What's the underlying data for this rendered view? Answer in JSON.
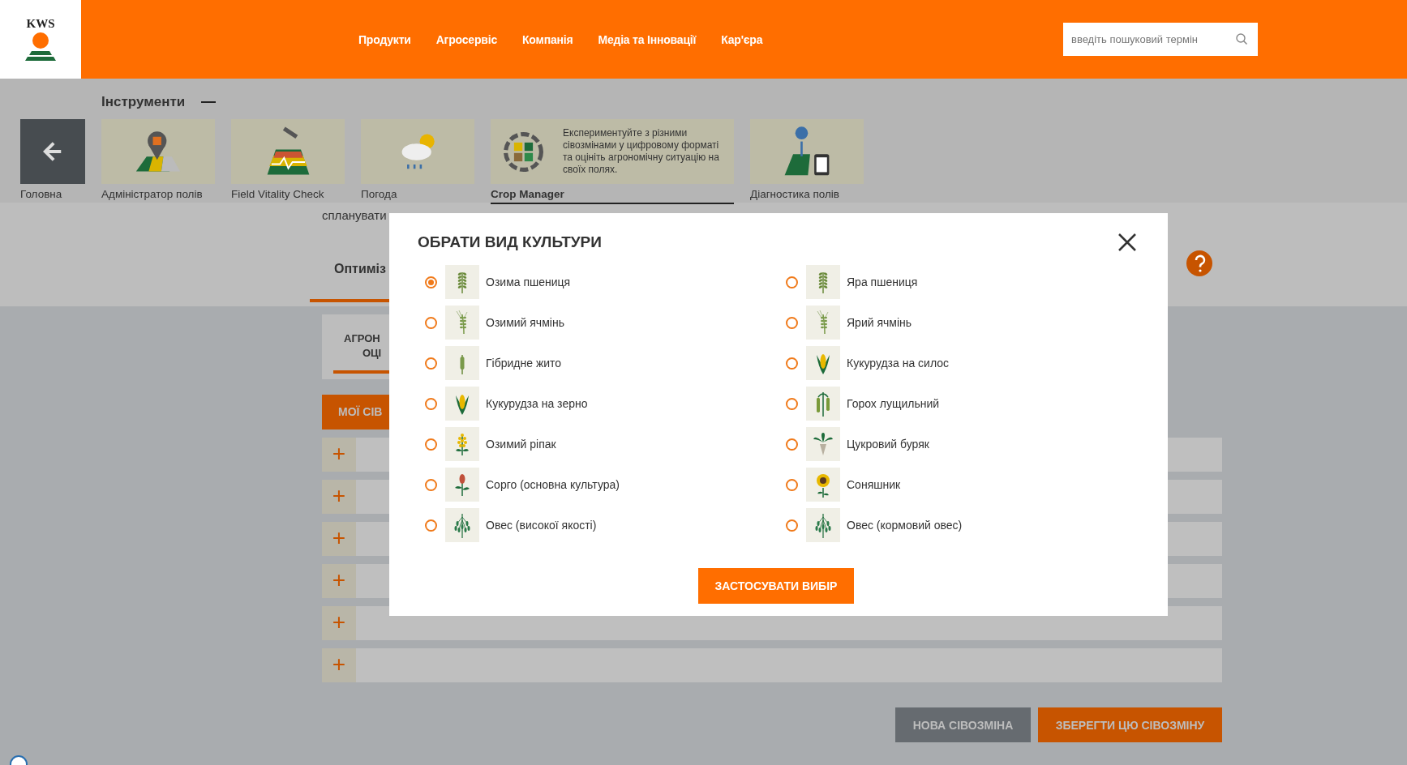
{
  "header": {
    "logo": "KWS",
    "nav": [
      "Продукти",
      "Агросервіс",
      "Компанія",
      "Медіа та Інновації",
      "Кар'єра"
    ],
    "search": {
      "placeholder": "введіть пошуковий термін"
    }
  },
  "tools": {
    "title": "Інструменти",
    "items": [
      {
        "kind": "back",
        "label": "Головна",
        "selected": false
      },
      {
        "kind": "field-admin",
        "label": "Адміністратор полів",
        "selected": false
      },
      {
        "kind": "vitality",
        "label": "Field Vitality Check",
        "selected": false
      },
      {
        "kind": "weather",
        "label": "Погода",
        "selected": false
      },
      {
        "kind": "crop-manager",
        "label": "Crop Manager",
        "description": "Експериментуйте з різними сівозмінами у цифровому форматі та оцініть агрономічну ситуацію на своїх полях.",
        "selected": true
      },
      {
        "kind": "diagnostics",
        "label": "Діагностика полів",
        "selected": false
      }
    ]
  },
  "intro": "спланувати",
  "tab": "Оптиміз",
  "card_lines": [
    "АГРОН",
    "ОЦІ"
  ],
  "my_rotations_button": "МОЇ СІВ",
  "rotation_rows": [
    "+",
    "+",
    "+",
    "+",
    "+",
    "+"
  ],
  "footer_buttons": [
    {
      "kind": "secondary",
      "label": "НОВА СІВОЗМІНА"
    },
    {
      "kind": "primary",
      "label": "ЗБЕРЕГТИ ЦЮ СІВОЗМІНУ"
    }
  ],
  "dialog": {
    "title": "ОБРАТИ ВИД КУЛЬТУРИ",
    "crops": [
      {
        "kind": "wheat",
        "label": "Озима пшениця",
        "selected": true
      },
      {
        "kind": "wheat",
        "label": "Яра пшениця",
        "selected": false
      },
      {
        "kind": "barley",
        "label": "Озимий ячмінь",
        "selected": false
      },
      {
        "kind": "barley",
        "label": "Ярий ячмінь",
        "selected": false
      },
      {
        "kind": "rye",
        "label": "Гібридне жито",
        "selected": false
      },
      {
        "kind": "corn",
        "label": "Кукурудза на силос",
        "selected": false
      },
      {
        "kind": "corn",
        "label": "Кукурудза на зерно",
        "selected": false
      },
      {
        "kind": "pea",
        "label": "Горох лущильний",
        "selected": false
      },
      {
        "kind": "rapeseed",
        "label": "Озимий ріпак",
        "selected": false
      },
      {
        "kind": "beet",
        "label": "Цукровий буряк",
        "selected": false
      },
      {
        "kind": "sorghum",
        "label": "Сорго (основна культура)",
        "selected": false
      },
      {
        "kind": "sunflower",
        "label": "Соняшник",
        "selected": false
      },
      {
        "kind": "oat",
        "label": "Овес (високої якості)",
        "selected": false
      },
      {
        "kind": "oat",
        "label": "Овес (кормовий овес)",
        "selected": false
      }
    ],
    "apply_button": "ЗАСТОСУВАТИ ВИБІР"
  }
}
